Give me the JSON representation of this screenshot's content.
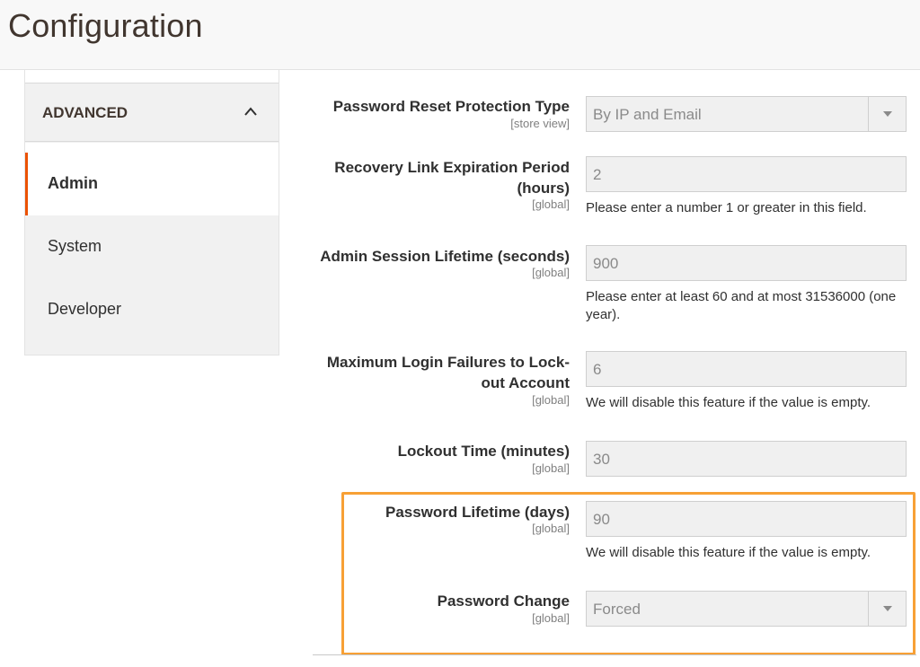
{
  "header": {
    "title": "Configuration"
  },
  "sidebar": {
    "section_title": "ADVANCED",
    "items": [
      {
        "label": "Admin",
        "active": true
      },
      {
        "label": "System",
        "active": false
      },
      {
        "label": "Developer",
        "active": false
      }
    ]
  },
  "form": {
    "rows": [
      {
        "label": "Password Reset Protection Type",
        "scope": "[store view]",
        "value": "By IP and Email",
        "type": "select"
      },
      {
        "label_line1": "Recovery Link Expiration Period",
        "label_line2": "(hours)",
        "scope": "[global]",
        "value": "2",
        "type": "text",
        "note": "Please enter a number 1 or greater in this field."
      },
      {
        "label": "Admin Session Lifetime (seconds)",
        "scope": "[global]",
        "value": "900",
        "type": "text",
        "note_line1": "Please enter at least 60 and at most 31536000 (one",
        "note_line2": "year)."
      },
      {
        "label_line1": "Maximum Login Failures to Lock-",
        "label_line2": "out Account",
        "scope": "[global]",
        "value": "6",
        "type": "text",
        "note": "We will disable this feature if the value is empty."
      },
      {
        "label": "Lockout Time (minutes)",
        "scope": "[global]",
        "value": "30",
        "type": "text"
      },
      {
        "label": "Password Lifetime (days)",
        "scope": "[global]",
        "value": "90",
        "type": "text",
        "note": "We will disable this feature if the value is empty."
      },
      {
        "label": "Password Change",
        "scope": "[global]",
        "value": "Forced",
        "type": "select"
      }
    ]
  },
  "colors": {
    "accent": "#eb5202",
    "highlight": "#f7a035"
  }
}
